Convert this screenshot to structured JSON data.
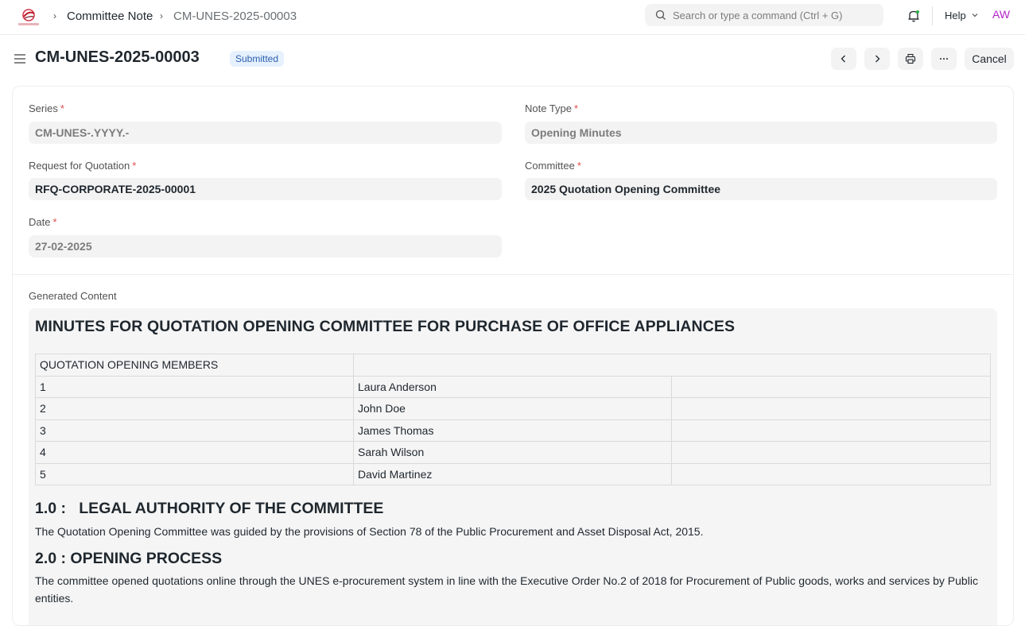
{
  "navbar": {
    "breadcrumbs": [
      "Committee Note",
      "CM-UNES-2025-00003"
    ],
    "search_placeholder": "Search or type a command (Ctrl + G)",
    "help_label": "Help",
    "avatar_initials": "AW"
  },
  "page": {
    "title": "CM-UNES-2025-00003",
    "status": "Submitted",
    "cancel_label": "Cancel"
  },
  "form": {
    "series": {
      "label": "Series",
      "value": "CM-UNES-.YYYY.-"
    },
    "note_type": {
      "label": "Note Type",
      "value": "Opening Minutes"
    },
    "rfq": {
      "label": "Request for Quotation",
      "value": "RFQ-CORPORATE-2025-00001"
    },
    "committee": {
      "label": "Committee",
      "value": "2025 Quotation Opening Committee"
    },
    "date": {
      "label": "Date",
      "value": "27-02-2025"
    },
    "required_mark": "*"
  },
  "content": {
    "label": "Generated Content",
    "doc_title": "MINUTES FOR QUOTATION OPENING COMMITTEE FOR PURCHASE OF OFFICE APPLIANCES",
    "members_header": "QUOTATION OPENING MEMBERS",
    "members": [
      {
        "no": "1",
        "name": "Laura Anderson"
      },
      {
        "no": "2",
        "name": "John Doe"
      },
      {
        "no": "3",
        "name": "James Thomas"
      },
      {
        "no": "4",
        "name": "Sarah Wilson"
      },
      {
        "no": "5",
        "name": "David Martinez"
      }
    ],
    "section1_heading": "1.0 :   LEGAL AUTHORITY OF THE COMMITTEE",
    "section1_text": "The Quotation Opening Committee was guided by the provisions of Section 78 of the Public Procurement and Asset Disposal Act, 2015.",
    "section2_heading": "2.0 : OPENING PROCESS",
    "section2_text": "The committee opened quotations online through the UNES e-procurement system in line with the Executive Order No.2 of 2018 for Procurement of Public goods, works and services by Public entities."
  },
  "colors": {
    "status_bg": "#e6f1fd",
    "status_text": "#2b5fb0",
    "avatar": "#b521c9",
    "required": "#e24c4c"
  }
}
